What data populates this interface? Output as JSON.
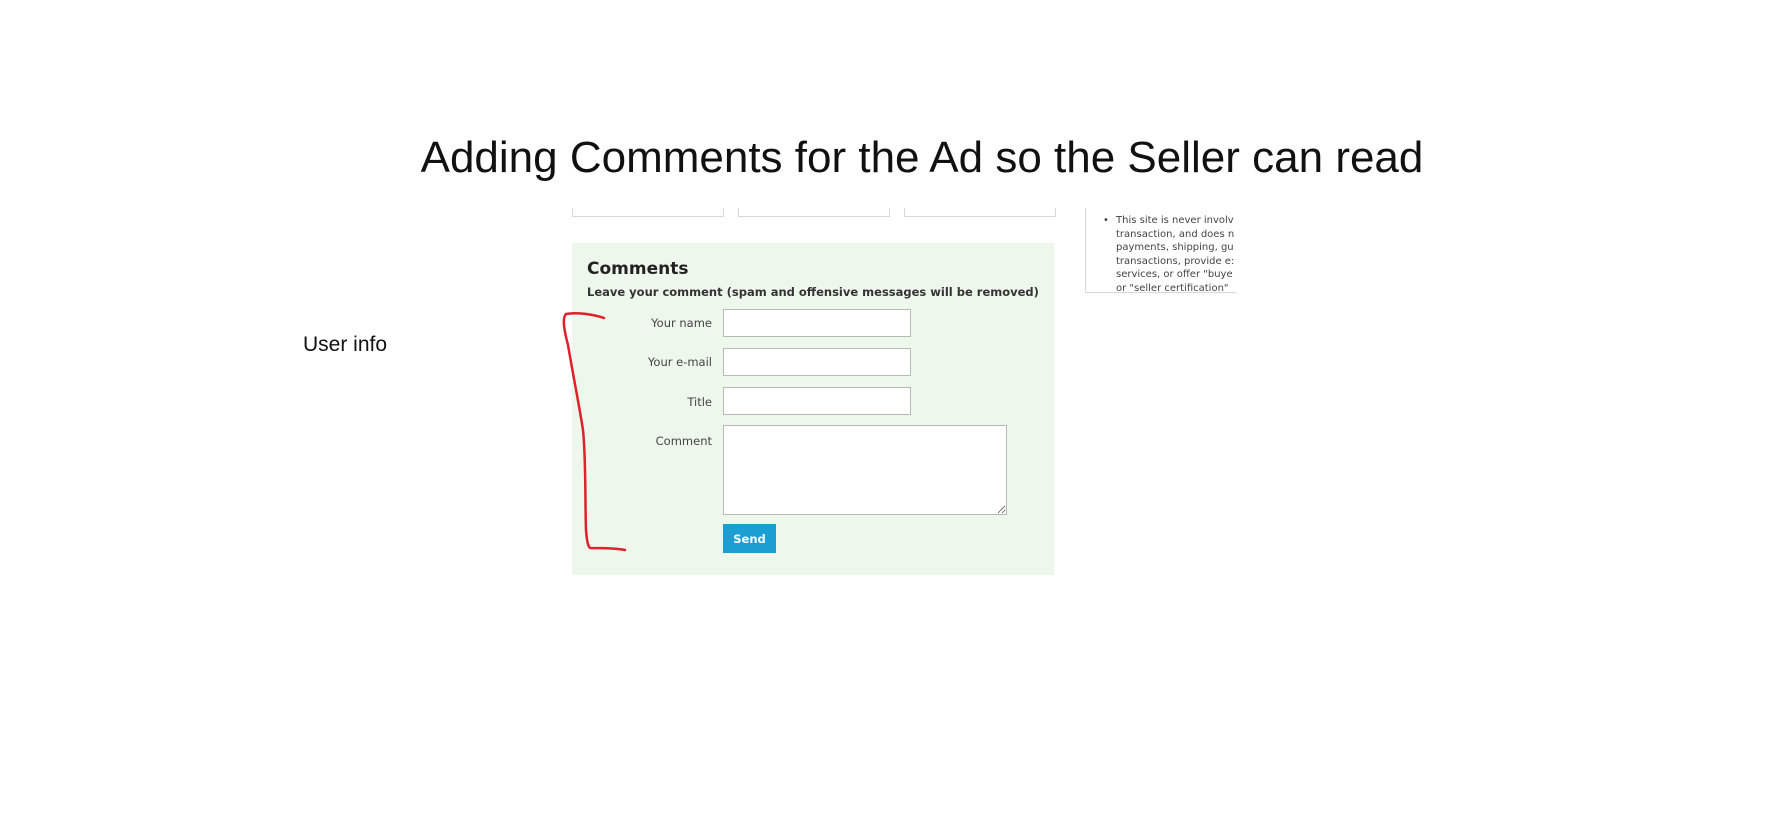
{
  "slide": {
    "title": "Adding Comments for the Ad so the Seller can read",
    "side_label": "User info"
  },
  "comments_form": {
    "heading": "Comments",
    "subheading": "Leave your comment (spam and offensive messages will be removed)",
    "fields": [
      {
        "label": "Your name",
        "value": ""
      },
      {
        "label": "Your e-mail",
        "value": ""
      },
      {
        "label": "Title",
        "value": ""
      }
    ],
    "comment_label": "Comment",
    "comment_value": "",
    "send_label": "Send"
  },
  "notice": {
    "lines": [
      "This site is never involv",
      "transaction, and does n",
      "payments, shipping, gu",
      "transactions, provide e:",
      "services, or offer \"buye",
      "or \"seller certification\""
    ]
  },
  "colors": {
    "panel_background": "#eef7ec",
    "send_button": "#1b9ed2",
    "annotation": "#e0202a"
  }
}
